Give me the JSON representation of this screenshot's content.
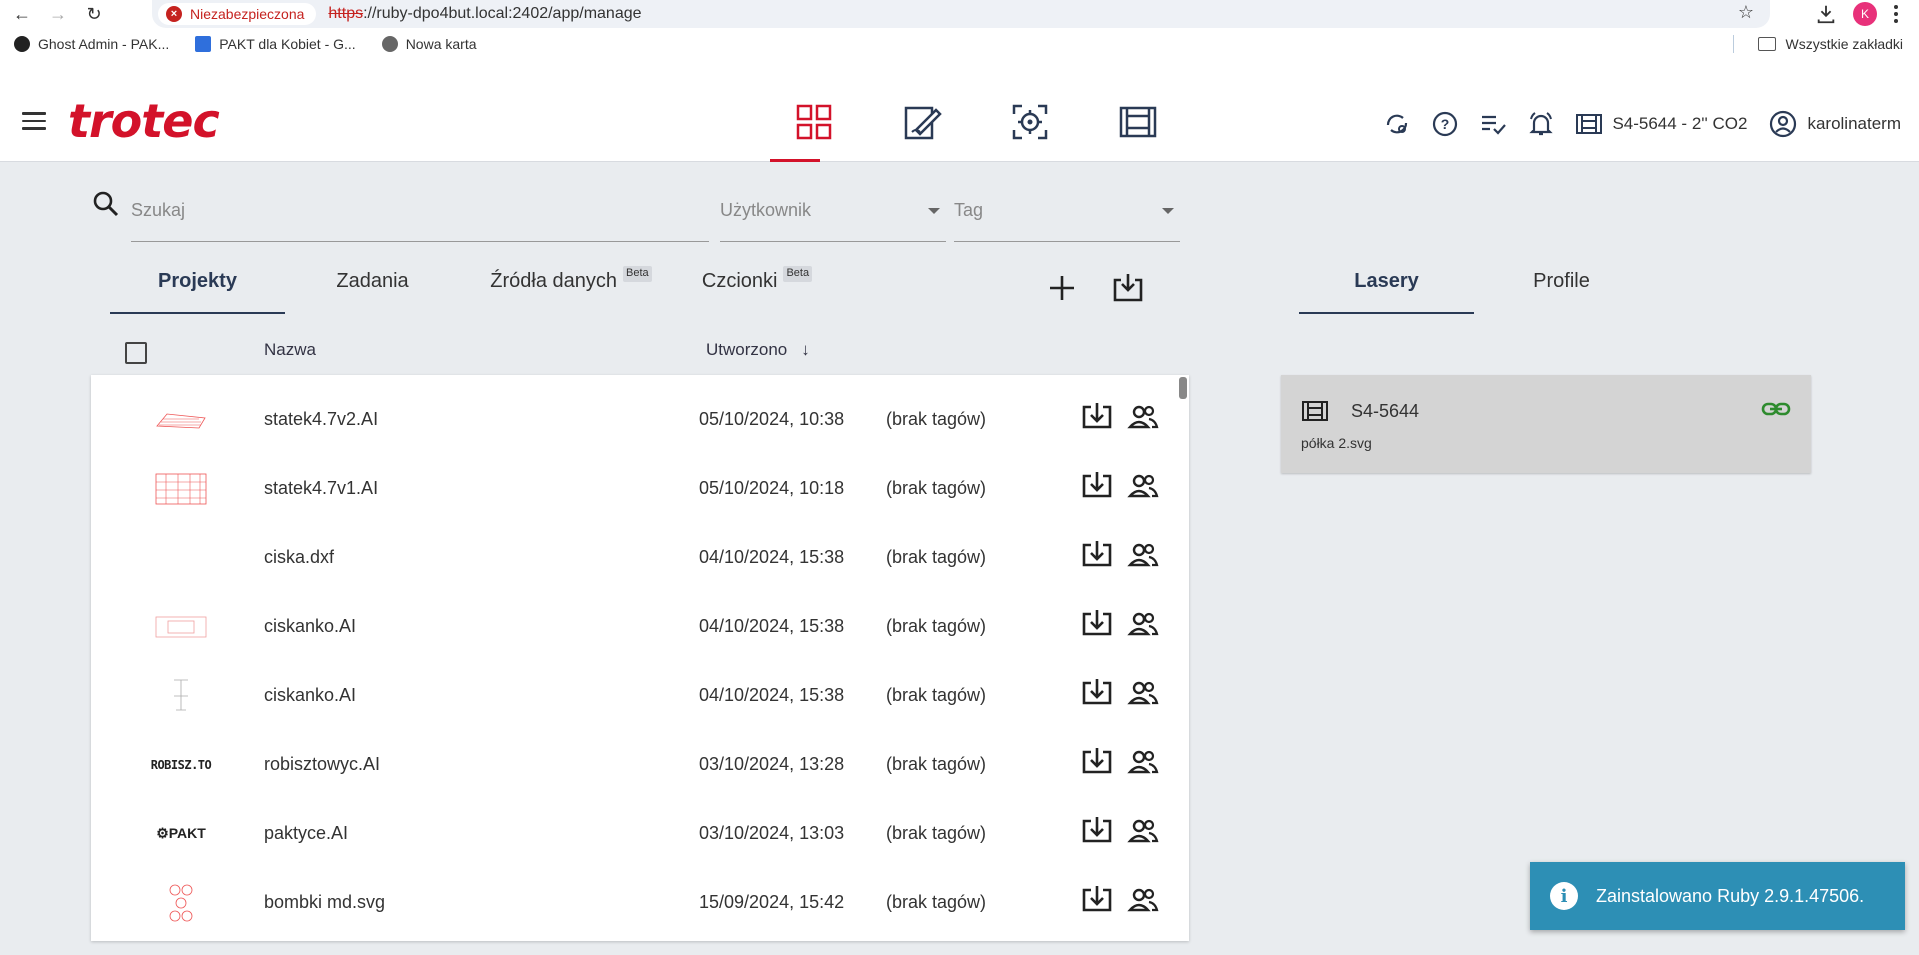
{
  "browser": {
    "security_label": "Niezabezpieczona",
    "url_scheme": "https",
    "url_rest": "://ruby-dpo4but.local:2402/app/manage",
    "profile_initial": "K"
  },
  "bookmarks": {
    "items": [
      {
        "label": "Ghost Admin - PAK..."
      },
      {
        "label": "PAKT dla Kobiet - G..."
      },
      {
        "label": "Nowa karta"
      }
    ],
    "all_bookmarks": "Wszystkie zakładki"
  },
  "header": {
    "logo": "trotec",
    "laser_label": "S4-5644 - 2'' CO2",
    "user_label": "karolinaterm"
  },
  "filters": {
    "search_placeholder": "Szukaj",
    "user_placeholder": "Użytkownik",
    "tag_placeholder": "Tag"
  },
  "tabs": {
    "projects": "Projekty",
    "jobs": "Zadania",
    "data_sources": "Źródła danych",
    "fonts": "Czcionki",
    "beta": "Beta"
  },
  "table": {
    "col_name": "Nazwa",
    "col_created": "Utworzono",
    "sort_arrow": "↓",
    "rows": [
      {
        "name": "statek4.7v2.AI",
        "date": "05/10/2024, 10:38",
        "tags": "(brak tagów)",
        "thumb": "red-lines"
      },
      {
        "name": "statek4.7v1.AI",
        "date": "05/10/2024, 10:18",
        "tags": "(brak tagów)",
        "thumb": "red-grid"
      },
      {
        "name": "ciska.dxf",
        "date": "04/10/2024, 15:38",
        "tags": "(brak tagów)",
        "thumb": "none"
      },
      {
        "name": "ciskanko.AI",
        "date": "04/10/2024, 15:38",
        "tags": "(brak tagów)",
        "thumb": "red-frame"
      },
      {
        "name": "ciskanko.AI",
        "date": "04/10/2024, 15:38",
        "tags": "(brak tagów)",
        "thumb": "grey-figure"
      },
      {
        "name": "robisztowyc.AI",
        "date": "03/10/2024, 13:28",
        "tags": "(brak tagów)",
        "thumb": "text-robisz"
      },
      {
        "name": "paktyce.AI",
        "date": "03/10/2024, 13:03",
        "tags": "(brak tagów)",
        "thumb": "text-pakt"
      },
      {
        "name": "bombki md.svg",
        "date": "15/09/2024, 15:42",
        "tags": "(brak tagów)",
        "thumb": "red-ornaments"
      }
    ],
    "thumb_text_robisz": "ROBISZ.TO",
    "thumb_text_pakt": "PAKT"
  },
  "right_panel": {
    "tab_lasers": "Lasery",
    "tab_profiles": "Profile",
    "laser_card": {
      "name": "S4-5644",
      "file": "półka 2.svg"
    }
  },
  "toast": {
    "message": "Zainstalowano Ruby 2.9.1.47506.",
    "icon": "i"
  },
  "colors": {
    "brand_red": "#d3122a",
    "toast_blue": "#2d8fb5",
    "link_green": "#2e8b2e",
    "tab_active": "#2a3a55"
  }
}
